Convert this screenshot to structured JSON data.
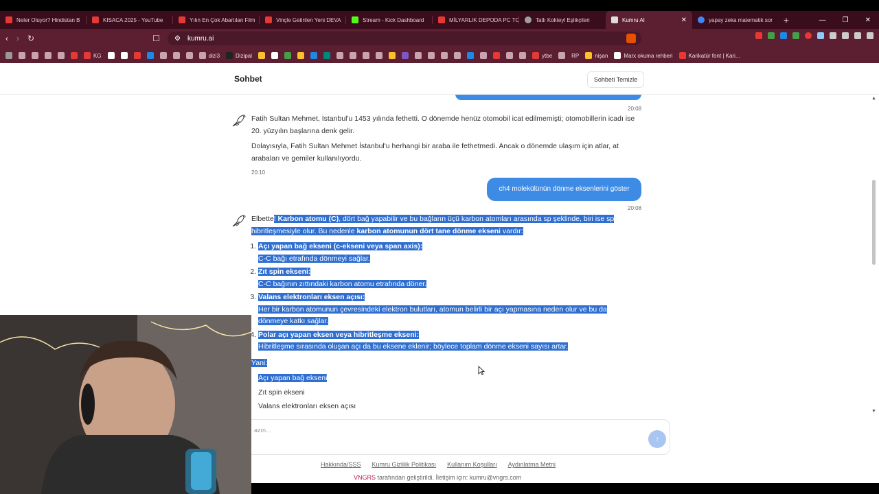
{
  "browser": {
    "tabs": [
      {
        "label": "Neler Oluyor? Hindistan B",
        "color": "#e53935"
      },
      {
        "label": "KISACA 2025 - YouTube",
        "color": "#e53935"
      },
      {
        "label": "Yılın En Çok Abartılan Film",
        "color": "#e53935"
      },
      {
        "label": "Vinçle Getirilen Yeni DEVA",
        "color": "#e53935"
      },
      {
        "label": "Stream - Kick Dashboard",
        "color": "#53fc18"
      },
      {
        "label": "MİLYARLIK DEPODA PC TO",
        "color": "#e53935"
      },
      {
        "label": "Tatlı Kokteyl Eşlikçileri",
        "color": "#9e9e9e"
      },
      {
        "label": "Kumru AI",
        "color": "#ffffff"
      },
      {
        "label": "yapay zeka matematik sor",
        "color": "#4285f4"
      }
    ],
    "url": "kumru.ai",
    "bookmarks": [
      "KG",
      "dizi3",
      "Dizipal",
      "ytbe",
      "RP",
      "nişan",
      "Marx okuma rehberi",
      "Karikatür font | Kari..."
    ]
  },
  "header": {
    "title": "Sohbet",
    "clear_label": "Sohbeti Temizle"
  },
  "chat": {
    "time_1": "20:08",
    "bot_1": {
      "p1": "Fatih Sultan Mehmet, İstanbul'u 1453 yılında fethetti. O dönemde henüz otomobil icat edilmemişti; otomobillerin icadı ise 20. yüzyılın başlarına denk gelir.",
      "p2": "Dolayısıyla, Fatih Sultan Mehmet İstanbul'u herhangi bir araba ile fethetmedi. Ancak o dönemde ulaşım için atlar, at arabaları ve gemiler kullanılıyordu.",
      "time": "20:10"
    },
    "user_1": {
      "text": "ch4 molekülünün dönme eksenlerini göster",
      "time": "20:08"
    },
    "bot_2": {
      "intro_start": "Elbette",
      "intro_sel_1": "! ",
      "intro_bold_1": "Karbon atomu (C)",
      "intro_mid": ", dört bağ yapabilir ve bu bağların üçü karbon atomları arasında sp şeklinde, biri ise sp hibritleşmesiyle olur. Bu nedenle ",
      "intro_bold_2": "karbon atomunun dört tane dönme ekseni",
      "intro_end": " vardır:",
      "steps": [
        {
          "title": "Açı yapan bağ ekseni (c-ekseni veya span axis):",
          "desc": "C-C bağı etrafında dönmeyi sağlar."
        },
        {
          "title": "Zıt spin ekseni:",
          "desc": "C-C bağının zıttındaki karbon atomu etrafında döner."
        },
        {
          "title": "Valans elektronları eksen açısı:",
          "desc": "Her bir karbon atomunun çevresindeki elektron bulutları, atomun belirli bir açı yapmasına neden olur ve bu da dönmeye katkı sağlar."
        },
        {
          "title": "Polar açı yapan eksen veya hibritleşme ekseni:",
          "desc": "Hibritleşme sırasında oluşan açı da bu eksene eklenir; böylece toplam dönme ekseni sayısı artar."
        }
      ],
      "summary_label": "Yani:",
      "summary": [
        "Açı yapan bağ ekseni",
        "Zıt spin ekseni",
        "Valans elektronları eksen açısı"
      ]
    }
  },
  "composer": {
    "placeholder": "azın...",
    "send_icon": "arrow-up-icon"
  },
  "footer": {
    "links": [
      "Hakkında/SSS",
      "Kumru Gizlilik Politikası",
      "Kullanım Koşulları",
      "Aydınlatma Metni"
    ],
    "brand": "VNGRS",
    "line": " tarafından geliştirildi. İletişim için: kumru@vngrs.com"
  },
  "colors": {
    "tabbar": "#3a0d1c",
    "toolbar": "#5b1f31",
    "user_bubble": "#3e8be6",
    "selection": "#2f6fd1",
    "brand": "#c2185b"
  }
}
